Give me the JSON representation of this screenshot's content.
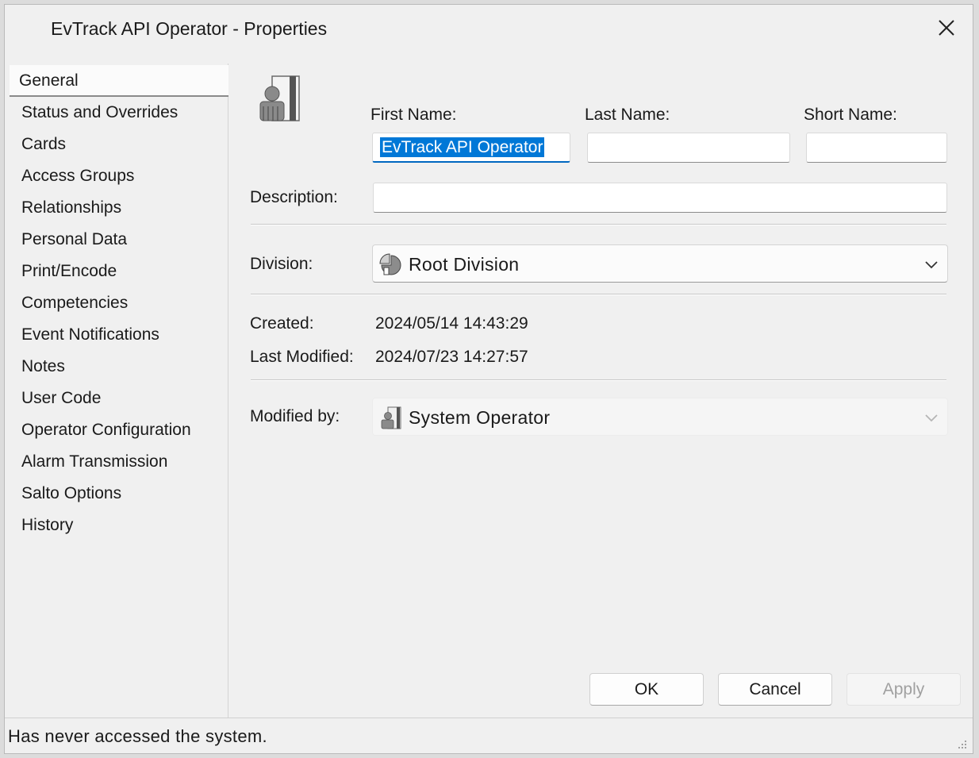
{
  "window": {
    "title": "EvTrack API Operator - Properties"
  },
  "sidebar": {
    "items": [
      {
        "label": "General",
        "active": true
      },
      {
        "label": "Status and Overrides"
      },
      {
        "label": "Cards"
      },
      {
        "label": "Access Groups"
      },
      {
        "label": "Relationships"
      },
      {
        "label": "Personal Data"
      },
      {
        "label": "Print/Encode"
      },
      {
        "label": "Competencies"
      },
      {
        "label": "Event Notifications"
      },
      {
        "label": "Notes"
      },
      {
        "label": "User Code"
      },
      {
        "label": "Operator Configuration"
      },
      {
        "label": "Alarm Transmission"
      },
      {
        "label": "Salto Options"
      },
      {
        "label": "History"
      }
    ]
  },
  "form": {
    "first_name": {
      "label": "First Name:",
      "value": "EvTrack API Operator"
    },
    "last_name": {
      "label": "Last Name:",
      "value": ""
    },
    "short_name": {
      "label": "Short Name:",
      "value": ""
    },
    "description": {
      "label": "Description:",
      "value": ""
    },
    "division": {
      "label": "Division:",
      "value": "Root Division",
      "icon": "division-icon"
    },
    "created": {
      "label": "Created:",
      "value": "2024/05/14 14:43:29"
    },
    "last_modified": {
      "label": "Last Modified:",
      "value": "2024/07/23 14:27:57"
    },
    "modified_by": {
      "label": "Modified by:",
      "value": "System Operator",
      "icon": "operator-icon"
    }
  },
  "buttons": {
    "ok": "OK",
    "cancel": "Cancel",
    "apply": "Apply"
  },
  "status": {
    "text": "Has never accessed the system."
  },
  "colors": {
    "selection": "#0078d7",
    "focus_underline": "#0067c0",
    "background": "#f0f0f0"
  }
}
